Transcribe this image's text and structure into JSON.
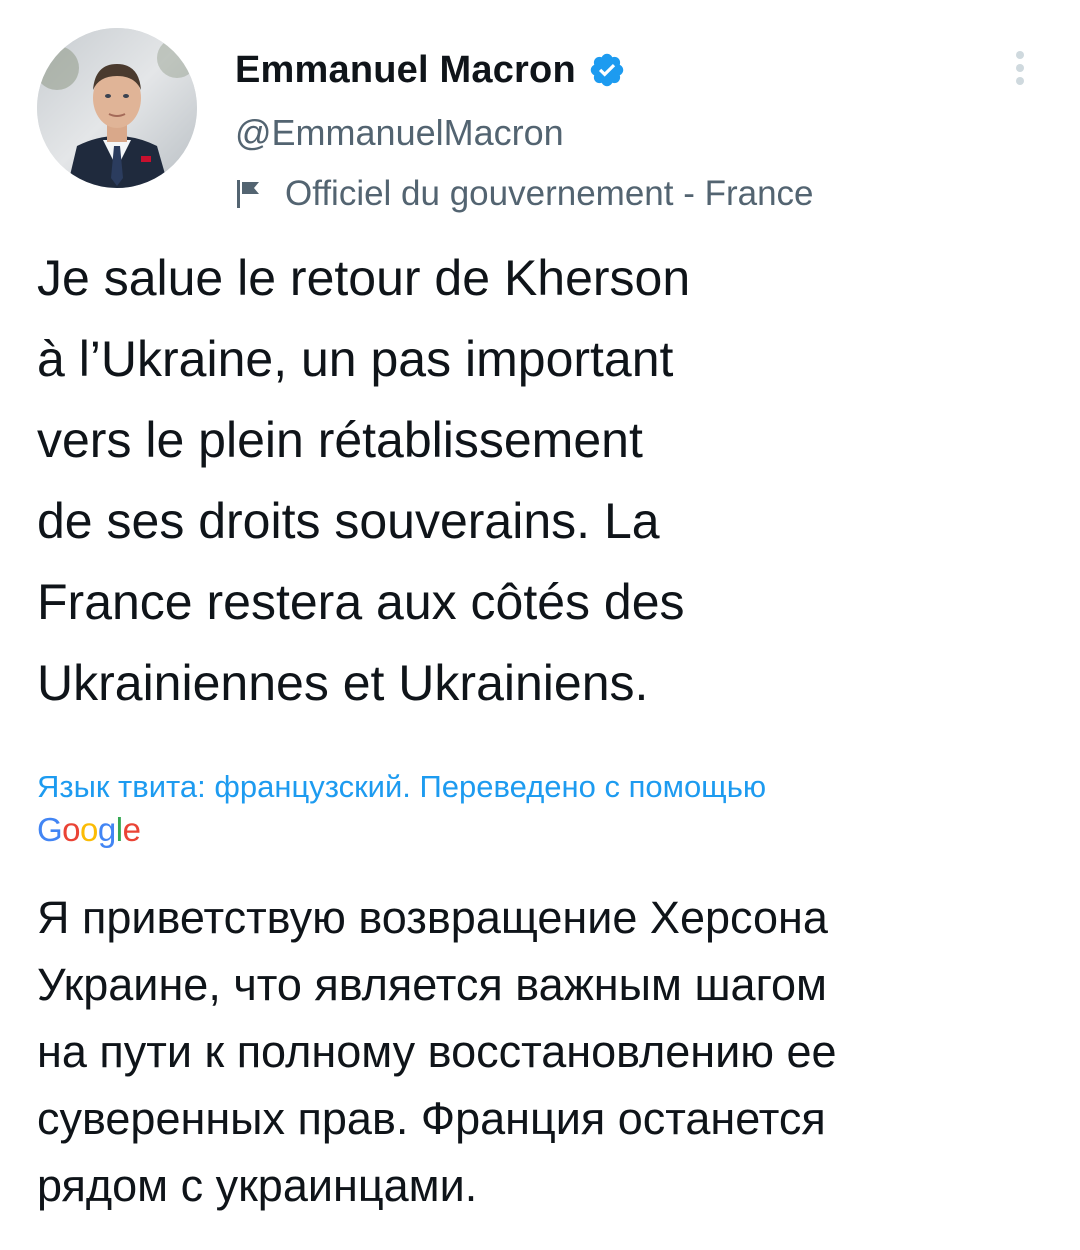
{
  "author": {
    "display_name": "Emmanuel Macron",
    "handle": "@EmmanuelMacron",
    "label": "Officiel du gouvernement - France",
    "avatar_icon": "profile-photo",
    "verified_icon": "verified-badge-icon",
    "label_icon": "flag-icon"
  },
  "tweet": {
    "text_lines": [
      "Je salue le retour de Kherson",
      "à l’Ukraine, un pas important",
      "vers le plein rétablissement",
      "de ses droits souverains. La",
      "France restera aux côtés des",
      "Ukrainiennes et Ukrainiens."
    ]
  },
  "translation": {
    "notice": "Язык твита: французский. Переведено с помощью",
    "provider_letters": [
      "G",
      "o",
      "o",
      "g",
      "l",
      "e"
    ],
    "text_lines": [
      "Я приветствую возвращение Херсона",
      "Украине, что является важным шагом",
      "на пути к полному восстановлению ее",
      "суверенных прав. Франция останется",
      "рядом с украинцами."
    ]
  },
  "colors": {
    "text_primary": "#0f1419",
    "text_secondary": "#536471",
    "link": "#1d9bf0",
    "verified": "#1d9bf0"
  }
}
